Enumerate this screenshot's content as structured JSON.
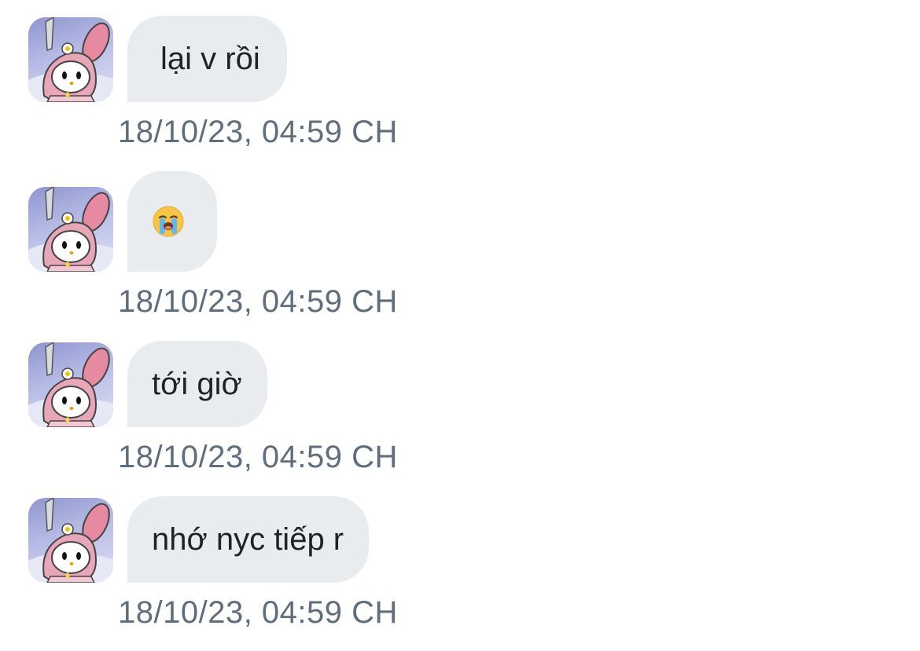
{
  "messages": [
    {
      "text": "lại v rồi",
      "timestamp": "18/10/23, 04:59 CH"
    },
    {
      "text": "",
      "emoji": "loudly-crying-face",
      "timestamp": "18/10/23, 04:59 CH"
    },
    {
      "text": "tới giờ",
      "timestamp": "18/10/23, 04:59 CH"
    },
    {
      "text": "nhớ nyc tiếp r",
      "timestamp": "18/10/23, 04:59 CH"
    }
  ],
  "colors": {
    "bubble_bg": "#e9ecef",
    "timestamp": "#5f6d7c",
    "text": "#1f2328"
  },
  "avatar": {
    "icon": "my-melody-avatar-icon"
  }
}
